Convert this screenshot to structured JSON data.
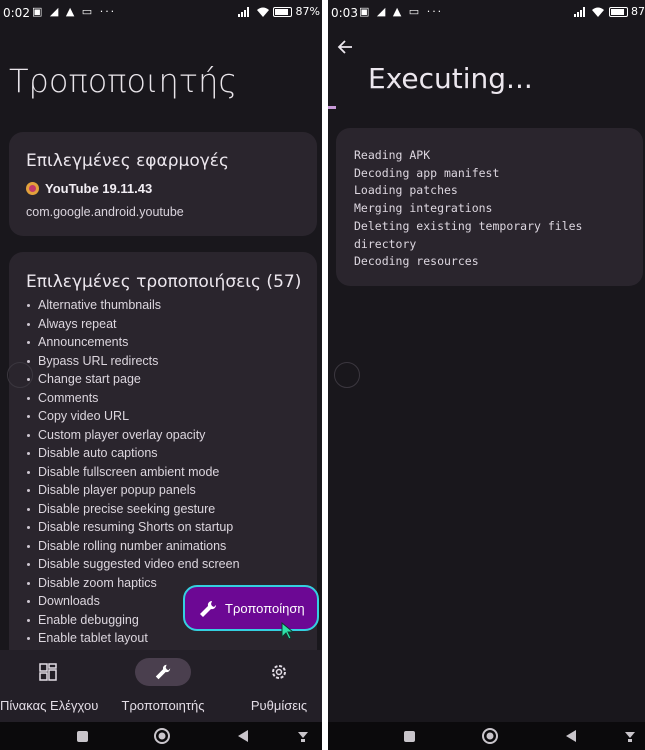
{
  "left": {
    "status": {
      "time": "0:02",
      "battery": "87%"
    },
    "title": "Τροποποιητής",
    "selected_apps": {
      "heading": "Επιλεγμένες εφαρμογές",
      "app_name": "YouTube 19.11.43",
      "package": "com.google.android.youtube"
    },
    "selected_patches": {
      "heading": "Επιλεγμένες τροποποιήσεις (57)",
      "items": [
        "Alternative thumbnails",
        "Always repeat",
        "Announcements",
        "Bypass URL redirects",
        "Change start page",
        "Comments",
        "Copy video URL",
        "Custom player overlay opacity",
        "Disable auto captions",
        "Disable fullscreen ambient mode",
        "Disable player popup panels",
        "Disable precise seeking gesture",
        "Disable resuming Shorts on startup",
        "Disable rolling number animations",
        "Disable suggested video end screen",
        "Disable zoom haptics",
        "Downloads",
        "Enable debugging",
        "Enable tablet layout"
      ]
    },
    "fab_label": "Τροποποίηση",
    "nav": {
      "dashboard": "Πίνακας Ελέγχου",
      "patcher": "Τροποποιητής",
      "settings": "Ρυθμίσεις"
    }
  },
  "right": {
    "status": {
      "time": "0:03",
      "battery": "87"
    },
    "title": "Executing...",
    "log": [
      "Reading APK",
      "Decoding app manifest",
      "Loading patches",
      "Merging integrations",
      "Deleting existing temporary files",
      "directory",
      "Decoding resources"
    ]
  },
  "colors": {
    "background": "#19171c",
    "card": "#2a252d",
    "fab": "#6c0894",
    "fab_border": "#34d0e0",
    "accent": "#c89ad8"
  }
}
